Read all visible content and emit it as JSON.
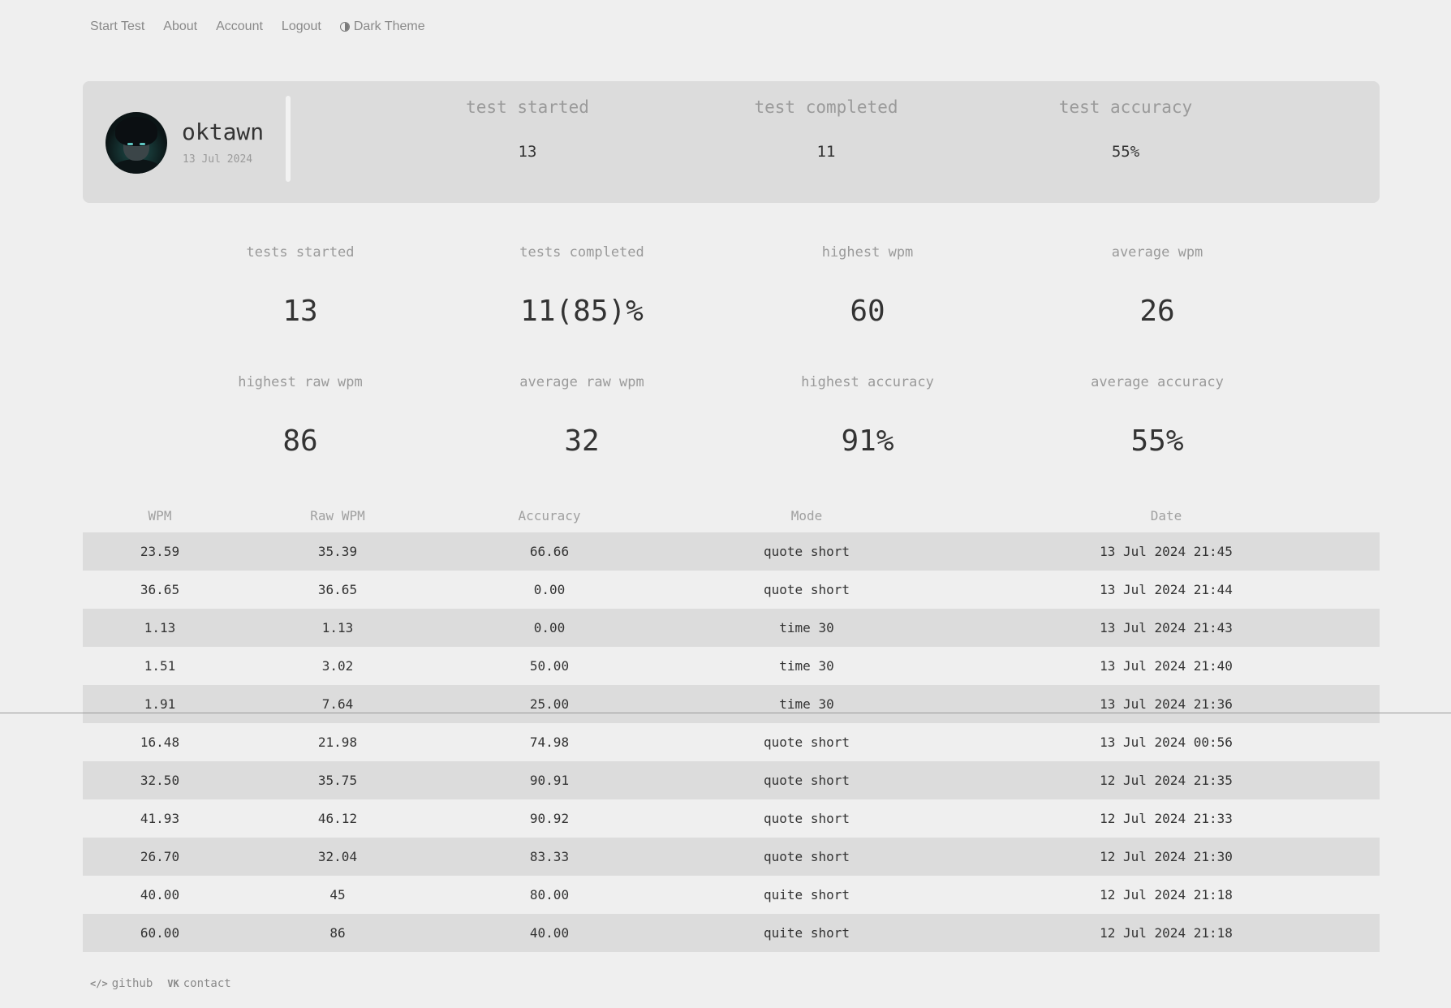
{
  "nav": {
    "start_test": "Start Test",
    "about": "About",
    "account": "Account",
    "logout": "Logout",
    "dark_theme": "Dark Theme"
  },
  "profile": {
    "username": "oktawn",
    "joined": "13 Jul 2024",
    "stats": [
      {
        "label": "test started",
        "value": "13"
      },
      {
        "label": "test completed",
        "value": "11"
      },
      {
        "label": "test accuracy",
        "value": "55%"
      }
    ]
  },
  "stats": [
    {
      "label": "tests started",
      "value": "13"
    },
    {
      "label": "tests completed",
      "value": "11(85)%"
    },
    {
      "label": "highest wpm",
      "value": "60"
    },
    {
      "label": "average wpm",
      "value": "26"
    },
    {
      "label": "highest raw wpm",
      "value": "86"
    },
    {
      "label": "average raw wpm",
      "value": "32"
    },
    {
      "label": "highest accuracy",
      "value": "91%"
    },
    {
      "label": "average accuracy",
      "value": "55%"
    }
  ],
  "history": {
    "columns": [
      "WPM",
      "Raw WPM",
      "Accuracy",
      "Mode",
      "Date"
    ],
    "rows": [
      [
        "23.59",
        "35.39",
        "66.66",
        "quote short",
        "13 Jul 2024 21:45"
      ],
      [
        "36.65",
        "36.65",
        "0.00",
        "quote short",
        "13 Jul 2024 21:44"
      ],
      [
        "1.13",
        "1.13",
        "0.00",
        "time 30",
        "13 Jul 2024 21:43"
      ],
      [
        "1.51",
        "3.02",
        "50.00",
        "time 30",
        "13 Jul 2024 21:40"
      ],
      [
        "1.91",
        "7.64",
        "25.00",
        "time 30",
        "13 Jul 2024 21:36"
      ],
      [
        "16.48",
        "21.98",
        "74.98",
        "quote short",
        "13 Jul 2024 00:56"
      ],
      [
        "32.50",
        "35.75",
        "90.91",
        "quote short",
        "12 Jul 2024 21:35"
      ],
      [
        "41.93",
        "46.12",
        "90.92",
        "quote short",
        "12 Jul 2024 21:33"
      ],
      [
        "26.70",
        "32.04",
        "83.33",
        "quote short",
        "12 Jul 2024 21:30"
      ],
      [
        "40.00",
        "45",
        "80.00",
        "quite short",
        "12 Jul 2024 21:18"
      ],
      [
        "60.00",
        "86",
        "40.00",
        "quite short",
        "12 Jul 2024 21:18"
      ]
    ]
  },
  "footer": {
    "github": "github",
    "contact": "contact",
    "github_icon": "</>",
    "contact_icon": "VK"
  }
}
